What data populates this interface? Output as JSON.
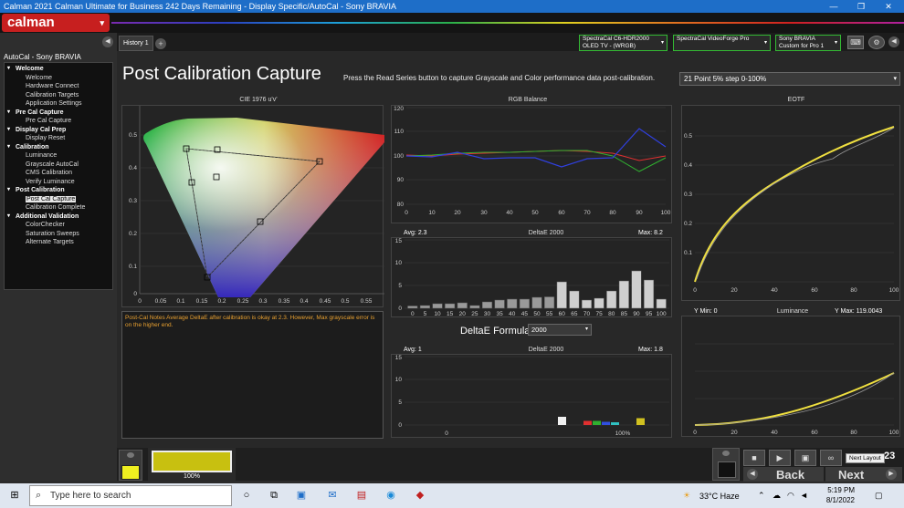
{
  "window": {
    "title": "Calman 2021 Calman Ultimate for Business 242 Days Remaining  - Display Specific/AutoCal - Sony BRAVIA",
    "min": "—",
    "max": "❐",
    "close": "✕"
  },
  "app": {
    "logo": "calman",
    "logo_caret": "▾"
  },
  "sidebar": {
    "title": "AutoCal - Sony BRAVIA",
    "collapse": "◀",
    "groups": [
      {
        "label": "Welcome",
        "items": [
          "Welcome",
          "Hardware Connect",
          "Calibration Targets",
          "Application Settings"
        ]
      },
      {
        "label": "Pre Cal Capture",
        "items": [
          "Pre Cal Capture"
        ]
      },
      {
        "label": "Display Cal Prep",
        "items": [
          "Display Reset"
        ]
      },
      {
        "label": "Calibration",
        "items": [
          "Luminance",
          "Grayscale AutoCal",
          "CMS Calibration",
          "Verify Luminance"
        ]
      },
      {
        "label": "Post Calibration",
        "items": [
          "Post Cal Capture",
          "Calibration Complete"
        ]
      },
      {
        "label": "Additional Validation",
        "items": [
          "ColorChecker",
          "Saturation Sweeps",
          "Alternate Targets"
        ]
      }
    ],
    "selected": "Post Cal Capture"
  },
  "tabs": {
    "history": "History 1",
    "add": "+"
  },
  "devices": [
    {
      "line1": "SpectraCal C6-HDR2000",
      "line2": "OLED TV - (WRGB)"
    },
    {
      "line1": "SpectraCal VideoForge Pro",
      "line2": ""
    },
    {
      "line1": "Sony BRAVIA",
      "line2": "Custom for Pro 1"
    }
  ],
  "dropdown_caret": "▾",
  "toolbar_icons": {
    "keyboard": "⌨",
    "settings": "⚙",
    "expand": "◀"
  },
  "page": {
    "title": "Post Calibration Capture",
    "instructions": "Press the Read Series button to capture Grayscale and Color performance data post-calibration.",
    "series_select": "21 Point 5% step 0-100%"
  },
  "cie": {
    "title": "CIE 1976 u'v'",
    "x_ticks": [
      "0",
      "0.05",
      "0.1",
      "0.15",
      "0.2",
      "0.25",
      "0.3",
      "0.35",
      "0.4",
      "0.45",
      "0.5",
      "0.55"
    ],
    "y_ticks": [
      "0.5",
      "0.4",
      "0.3",
      "0.2",
      "0.1",
      "0"
    ]
  },
  "notes": "Post-Cal Notes Average DeltaE after calibration is okay at 2.3. However, Max  grayscale error is on the higher end.",
  "rgb_balance": {
    "title": "RGB Balance",
    "y_ticks": [
      "120",
      "110",
      "100",
      "90",
      "80"
    ],
    "x_ticks": [
      "0",
      "10",
      "20",
      "30",
      "40",
      "50",
      "60",
      "70",
      "80",
      "90",
      "100"
    ]
  },
  "deltae_gray": {
    "title": "DeltaE 2000",
    "avg": "Avg: 2.3",
    "max": "Max: 8.2",
    "y_ticks": [
      "15",
      "10",
      "5",
      "0"
    ],
    "x_ticks": [
      "0",
      "5",
      "10",
      "15",
      "20",
      "25",
      "30",
      "35",
      "40",
      "45",
      "50",
      "55",
      "60",
      "65",
      "70",
      "75",
      "80",
      "85",
      "90",
      "95",
      "100"
    ],
    "values": [
      0.5,
      0.6,
      1.0,
      1.0,
      1.2,
      0.6,
      1.4,
      1.8,
      2.0,
      2.0,
      2.4,
      2.5,
      5.8,
      3.8,
      1.8,
      2.2,
      3.8,
      6.0,
      8.2,
      6.2,
      2.0
    ]
  },
  "formula": {
    "label": "DeltaE Formula",
    "value": "2000"
  },
  "deltae_color": {
    "title": "DeltaE 2000",
    "avg": "Avg: 1",
    "max": "Max: 1.8",
    "y_ticks": [
      "15",
      "10",
      "5",
      "0"
    ],
    "x_ticks": [
      "0",
      "100%"
    ],
    "bars": [
      {
        "value": 1.8,
        "color": "#f0f0f0"
      },
      {
        "value": 0.9,
        "color": "#e03030"
      },
      {
        "value": 0.9,
        "color": "#30b030"
      },
      {
        "value": 0.7,
        "color": "#3050e0"
      },
      {
        "value": 0.6,
        "color": "#30c0c0"
      },
      {
        "value": 1.5,
        "color": "#d0c020"
      }
    ]
  },
  "eotf": {
    "title": "EOTF",
    "y_ticks": [
      "0.5",
      "0.4",
      "0.3",
      "0.2",
      "0.1"
    ],
    "x_ticks": [
      "0",
      "20",
      "40",
      "60",
      "80",
      "100"
    ]
  },
  "luminance": {
    "title": "Luminance",
    "ymin": "Y Min: 0",
    "ymax": "Y Max: 119.0043",
    "x_ticks": [
      "0",
      "20",
      "40",
      "60",
      "80",
      "100"
    ]
  },
  "bottom": {
    "swatch_color": "#c8c010",
    "swatch_label": "100%",
    "back": "Back",
    "next": "Next",
    "tooltip": "Next Layout",
    "counter": "23"
  },
  "taskbar": {
    "search_placeholder": "Type here to search",
    "weather": "33°C  Haze",
    "time": "5:19 PM",
    "date": "8/1/2022"
  }
}
